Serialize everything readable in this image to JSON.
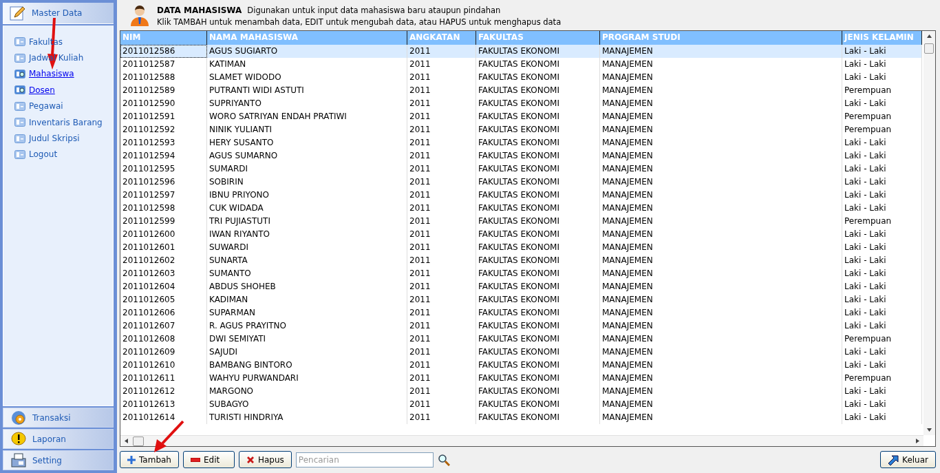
{
  "sidebar": {
    "header": "Master Data",
    "items": [
      {
        "label": "Fakultas",
        "highlighted": false
      },
      {
        "label": "Jadwal Kuliah",
        "highlighted": false
      },
      {
        "label": "Mahasiswa",
        "highlighted": true
      },
      {
        "label": "Dosen",
        "highlighted": true
      },
      {
        "label": "Pegawai",
        "highlighted": false
      },
      {
        "label": "Inventaris Barang",
        "highlighted": false
      },
      {
        "label": "Judul Skripsi",
        "highlighted": false
      },
      {
        "label": "Logout",
        "highlighted": false
      }
    ],
    "sections": [
      {
        "kind": "gear",
        "label": "Transaksi"
      },
      {
        "kind": "alert",
        "label": "Laporan"
      },
      {
        "kind": "fax",
        "label": "Setting"
      }
    ]
  },
  "header": {
    "title": "DATA MAHASISWA",
    "subtitle": "Digunakan untuk input data mahasiswa baru ataupun pindahan",
    "hint": "Klik TAMBAH untuk menambah data, EDIT untuk mengubah data, atau HAPUS untuk menghapus data"
  },
  "table": {
    "columns": [
      "NIM",
      "NAMA MAHASISWA",
      "ANGKATAN",
      "FAKULTAS",
      "PROGRAM STUDI",
      "JENIS KELAMIN"
    ],
    "rows": [
      {
        "cells": [
          "2011012586",
          "AGUS SUGIARTO",
          "2011",
          "FAKULTAS EKONOMI",
          "MANAJEMEN",
          "Laki - Laki"
        ],
        "selected": true
      },
      {
        "cells": [
          "2011012587",
          "KATIMAN",
          "2011",
          "FAKULTAS EKONOMI",
          "MANAJEMEN",
          "Laki - Laki"
        ],
        "selected": false
      },
      {
        "cells": [
          "2011012588",
          "SLAMET WIDODO",
          "2011",
          "FAKULTAS EKONOMI",
          "MANAJEMEN",
          "Laki - Laki"
        ],
        "selected": false
      },
      {
        "cells": [
          "2011012589",
          "PUTRANTI WIDI ASTUTI",
          "2011",
          "FAKULTAS EKONOMI",
          "MANAJEMEN",
          "Perempuan"
        ],
        "selected": false
      },
      {
        "cells": [
          "2011012590",
          "SUPRIYANTO",
          "2011",
          "FAKULTAS EKONOMI",
          "MANAJEMEN",
          "Laki - Laki"
        ],
        "selected": false
      },
      {
        "cells": [
          "2011012591",
          "WORO SATRIYAN ENDAH PRATIWI",
          "2011",
          "FAKULTAS EKONOMI",
          "MANAJEMEN",
          "Perempuan"
        ],
        "selected": false
      },
      {
        "cells": [
          "2011012592",
          "NINIK YULIANTI",
          "2011",
          "FAKULTAS EKONOMI",
          "MANAJEMEN",
          "Perempuan"
        ],
        "selected": false
      },
      {
        "cells": [
          "2011012593",
          "HERY SUSANTO",
          "2011",
          "FAKULTAS EKONOMI",
          "MANAJEMEN",
          "Laki - Laki"
        ],
        "selected": false
      },
      {
        "cells": [
          "2011012594",
          "AGUS SUMARNO",
          "2011",
          "FAKULTAS EKONOMI",
          "MANAJEMEN",
          "Laki - Laki"
        ],
        "selected": false
      },
      {
        "cells": [
          "2011012595",
          "SUMARDI",
          "2011",
          "FAKULTAS EKONOMI",
          "MANAJEMEN",
          "Laki - Laki"
        ],
        "selected": false
      },
      {
        "cells": [
          "2011012596",
          "SOBIRIN",
          "2011",
          "FAKULTAS EKONOMI",
          "MANAJEMEN",
          "Laki - Laki"
        ],
        "selected": false
      },
      {
        "cells": [
          "2011012597",
          "IBNU PRIYONO",
          "2011",
          "FAKULTAS EKONOMI",
          "MANAJEMEN",
          "Laki - Laki"
        ],
        "selected": false
      },
      {
        "cells": [
          "2011012598",
          "CUK WIDADA",
          "2011",
          "FAKULTAS EKONOMI",
          "MANAJEMEN",
          "Laki - Laki"
        ],
        "selected": false
      },
      {
        "cells": [
          "2011012599",
          "TRI PUJIASTUTI",
          "2011",
          "FAKULTAS EKONOMI",
          "MANAJEMEN",
          "Perempuan"
        ],
        "selected": false
      },
      {
        "cells": [
          "2011012600",
          "IWAN RIYANTO",
          "2011",
          "FAKULTAS EKONOMI",
          "MANAJEMEN",
          "Laki - Laki"
        ],
        "selected": false
      },
      {
        "cells": [
          "2011012601",
          "SUWARDI",
          "2011",
          "FAKULTAS EKONOMI",
          "MANAJEMEN",
          "Laki - Laki"
        ],
        "selected": false
      },
      {
        "cells": [
          "2011012602",
          "SUNARTA",
          "2011",
          "FAKULTAS EKONOMI",
          "MANAJEMEN",
          "Laki - Laki"
        ],
        "selected": false
      },
      {
        "cells": [
          "2011012603",
          "SUMANTO",
          "2011",
          "FAKULTAS EKONOMI",
          "MANAJEMEN",
          "Laki - Laki"
        ],
        "selected": false
      },
      {
        "cells": [
          "2011012604",
          "ABDUS SHOHEB",
          "2011",
          "FAKULTAS EKONOMI",
          "MANAJEMEN",
          "Laki - Laki"
        ],
        "selected": false
      },
      {
        "cells": [
          "2011012605",
          "KADIMAN",
          "2011",
          "FAKULTAS EKONOMI",
          "MANAJEMEN",
          "Laki - Laki"
        ],
        "selected": false
      },
      {
        "cells": [
          "2011012606",
          "SUPARMAN",
          "2011",
          "FAKULTAS EKONOMI",
          "MANAJEMEN",
          "Laki - Laki"
        ],
        "selected": false
      },
      {
        "cells": [
          "2011012607",
          "R. AGUS PRAYITNO",
          "2011",
          "FAKULTAS EKONOMI",
          "MANAJEMEN",
          "Laki - Laki"
        ],
        "selected": false
      },
      {
        "cells": [
          "2011012608",
          "DWI SEMIYATI",
          "2011",
          "FAKULTAS EKONOMI",
          "MANAJEMEN",
          "Perempuan"
        ],
        "selected": false
      },
      {
        "cells": [
          "2011012609",
          "SAJUDI",
          "2011",
          "FAKULTAS EKONOMI",
          "MANAJEMEN",
          "Laki - Laki"
        ],
        "selected": false
      },
      {
        "cells": [
          "2011012610",
          "BAMBANG BINTORO",
          "2011",
          "FAKULTAS EKONOMI",
          "MANAJEMEN",
          "Laki - Laki"
        ],
        "selected": false
      },
      {
        "cells": [
          "2011012611",
          "WAHYU PURWANDARI",
          "2011",
          "FAKULTAS EKONOMI",
          "MANAJEMEN",
          "Perempuan"
        ],
        "selected": false
      },
      {
        "cells": [
          "2011012612",
          "MARGONO",
          "2011",
          "FAKULTAS EKONOMI",
          "MANAJEMEN",
          "Laki - Laki"
        ],
        "selected": false
      },
      {
        "cells": [
          "2011012613",
          "SUBAGYO",
          "2011",
          "FAKULTAS EKONOMI",
          "MANAJEMEN",
          "Laki - Laki"
        ],
        "selected": false
      },
      {
        "cells": [
          "2011012614",
          "TURISTI HINDRIYA",
          "2011",
          "FAKULTAS EKONOMI",
          "MANAJEMEN",
          "Laki - Laki"
        ],
        "selected": false
      }
    ]
  },
  "toolbar": {
    "buttons": [
      {
        "kind": "add",
        "label": "Tambah"
      },
      {
        "kind": "edit",
        "label": "Edit"
      },
      {
        "kind": "delete",
        "label": "Hapus"
      }
    ],
    "search": {
      "placeholder": "Pencarian"
    },
    "exit": {
      "label": "Keluar"
    }
  }
}
